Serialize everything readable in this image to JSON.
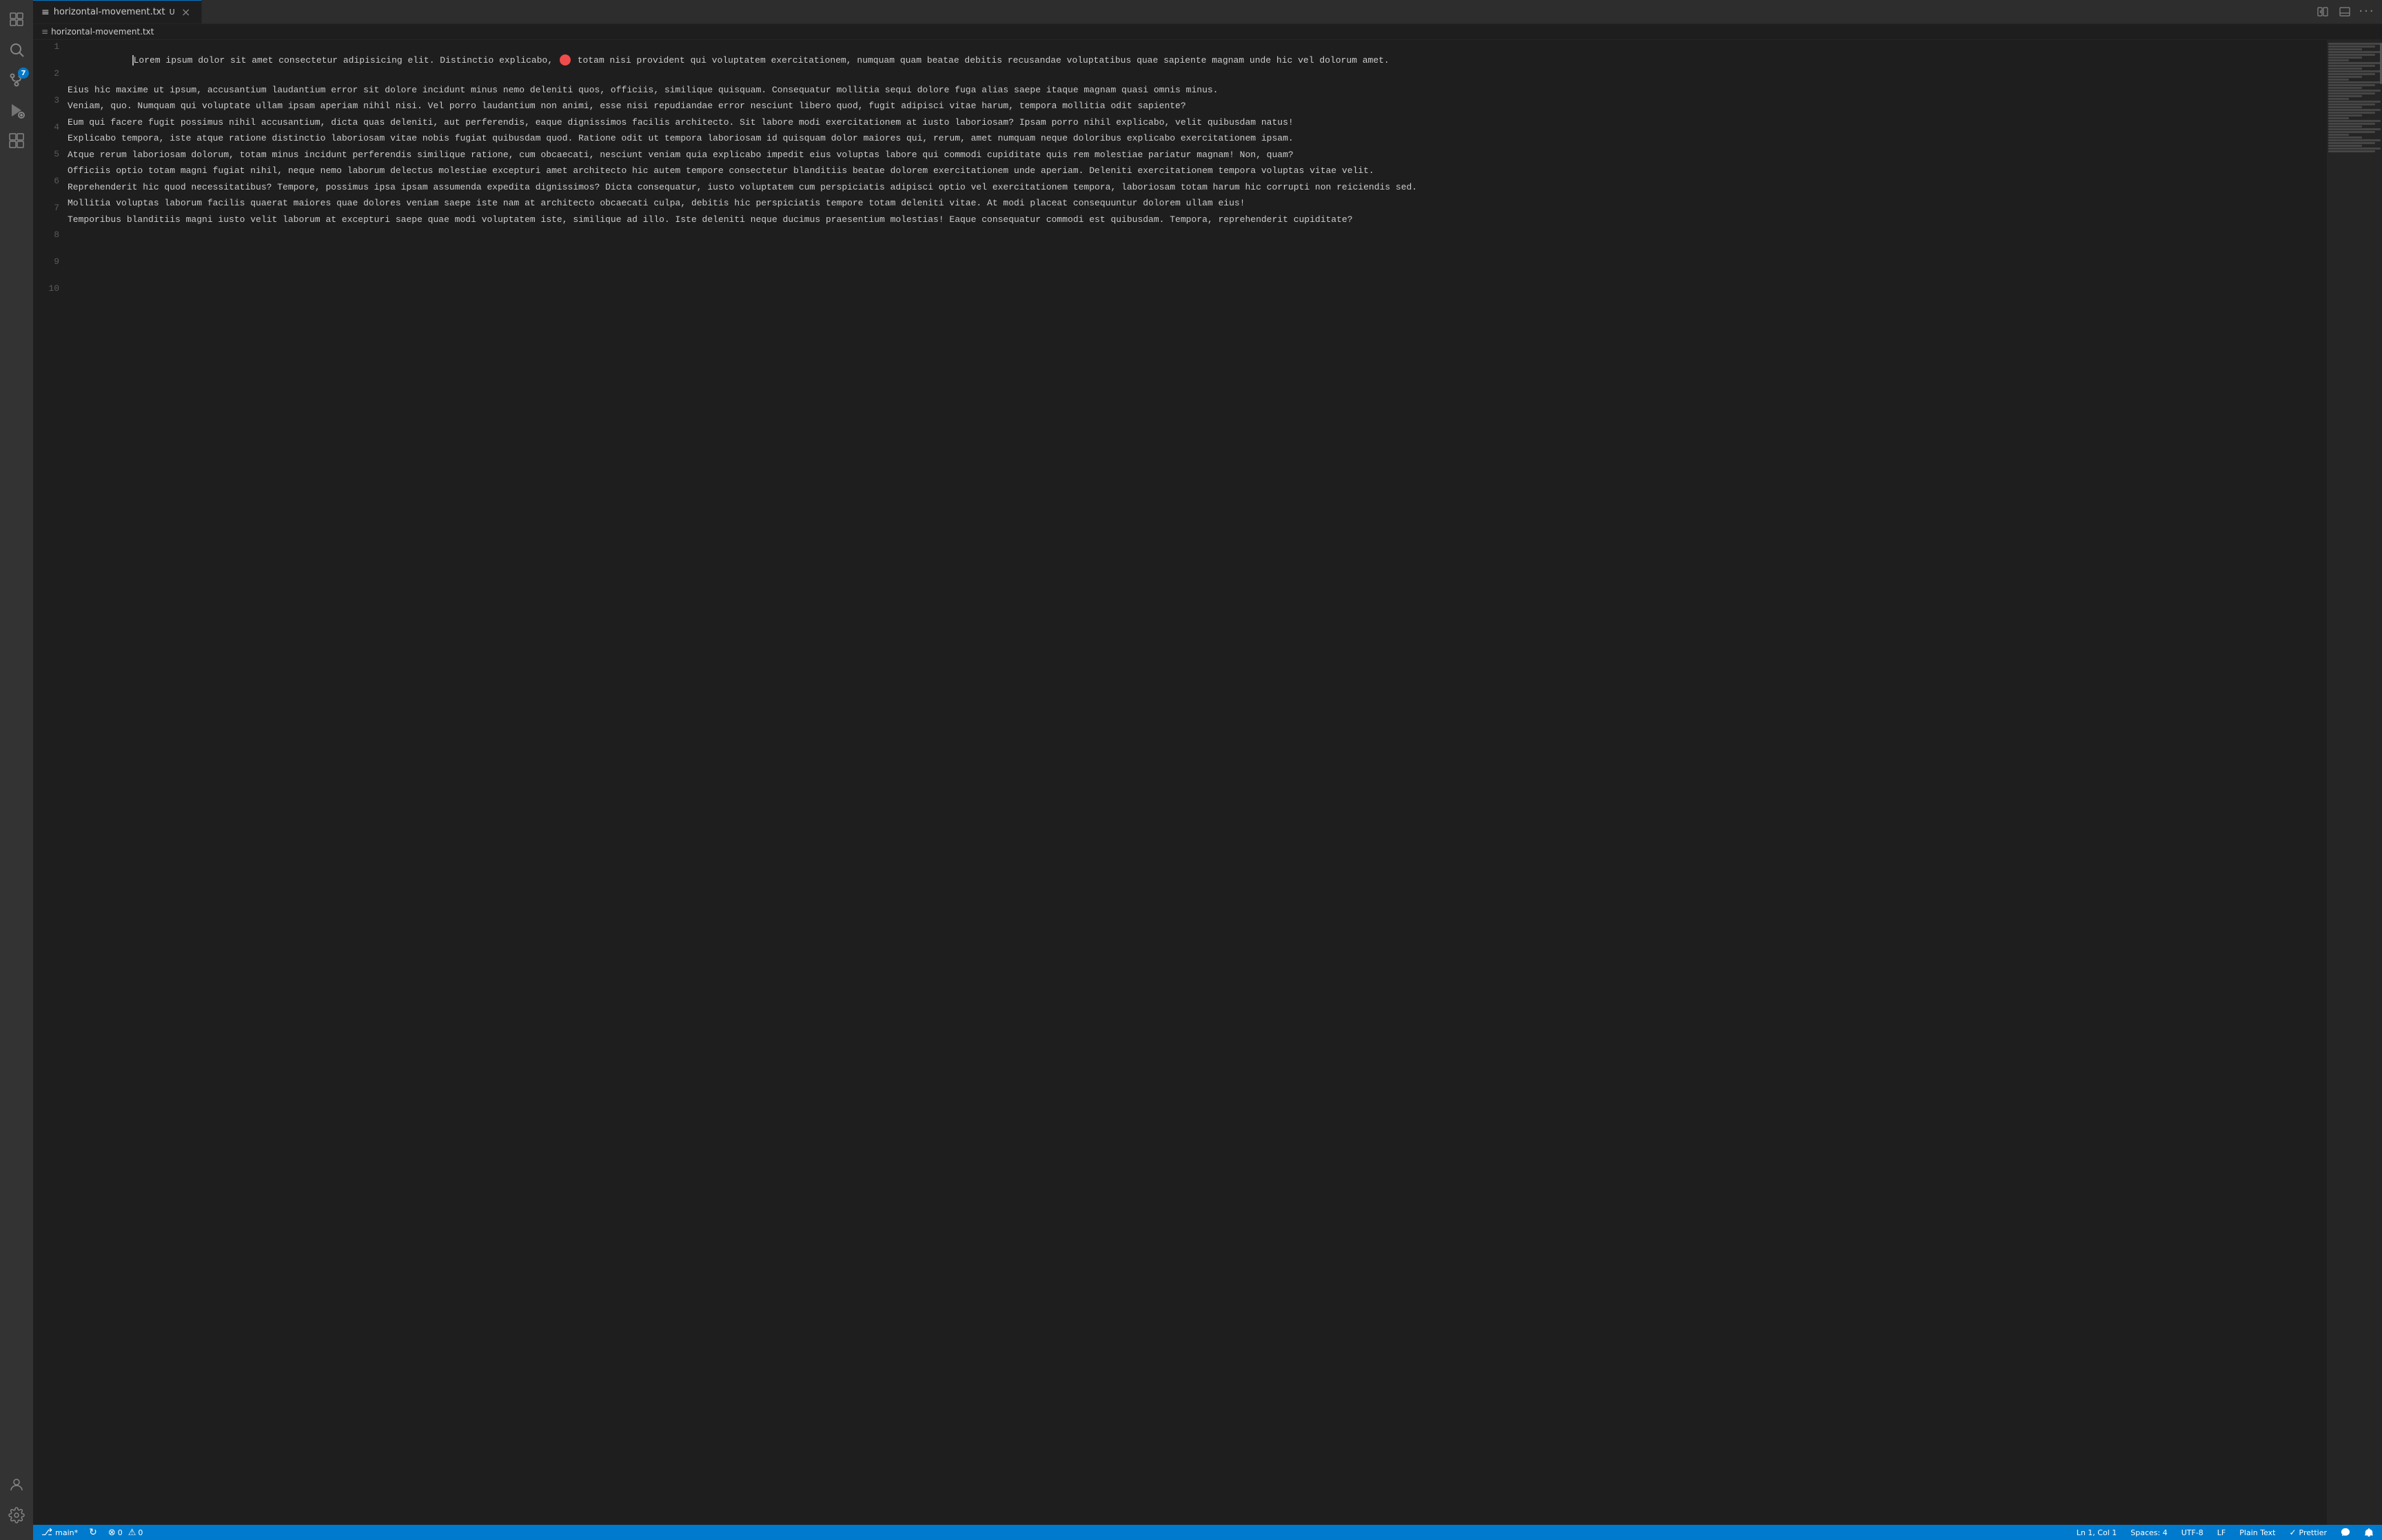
{
  "activityBar": {
    "icons": [
      {
        "name": "explorer-icon",
        "symbol": "⬜",
        "active": false,
        "badge": null
      },
      {
        "name": "search-icon",
        "symbol": "🔍",
        "active": false,
        "badge": null
      },
      {
        "name": "source-control-icon",
        "symbol": "⎇",
        "active": false,
        "badge": "7"
      },
      {
        "name": "run-debug-icon",
        "symbol": "▷",
        "active": false,
        "badge": null
      },
      {
        "name": "extensions-icon",
        "symbol": "⊞",
        "active": false,
        "badge": null
      }
    ],
    "bottomIcons": [
      {
        "name": "account-icon",
        "symbol": "👤",
        "active": false
      },
      {
        "name": "settings-icon",
        "symbol": "⚙",
        "active": false
      }
    ]
  },
  "tabs": [
    {
      "label": "horizontal-movement.txt",
      "modified": "U",
      "active": true,
      "icon": "≡"
    }
  ],
  "tabActions": [
    {
      "name": "split-editor-icon",
      "symbol": "⧉"
    },
    {
      "name": "toggle-panel-icon",
      "symbol": "▣"
    },
    {
      "name": "more-actions-icon",
      "symbol": "···"
    }
  ],
  "breadcrumb": {
    "icon": "≡",
    "filename": "horizontal-movement.txt"
  },
  "editor": {
    "lines": [
      {
        "num": 1,
        "text": "Lorem ipsum dolor sit amet consectetur adipisicing elit. Distinctio explicabo,  totam nisi provident qui voluptatem exercitationem, numquam quam beatae debitis recusandae voluptatibus quae sapiente magnam unde hic vel dolorum amet.",
        "hasBookmark": true,
        "hasCursor": true
      },
      {
        "num": 2,
        "text": "Eius hic maxime ut ipsum, accusantium laudantium error sit dolore incidunt minus nemo deleniti quos, officiis, similique quisquam. Consequatur mollitia sequi dolore fuga alias saepe itaque magnam quasi omnis minus.",
        "hasBookmark": false,
        "hasCursor": false
      },
      {
        "num": 3,
        "text": "Veniam, quo. Numquam qui voluptate ullam ipsam aperiam nihil nisi. Vel porro laudantium non animi, esse nisi repudiandae error nesciunt libero quod, fugit adipisci vitae harum, tempora mollitia odit sapiente?",
        "hasBookmark": false,
        "hasCursor": false
      },
      {
        "num": 4,
        "text": "Eum qui facere fugit possimus nihil accusantium, dicta quas deleniti, aut perferendis, eaque dignissimos facilis architecto. Sit labore modi exercitationem at iusto laboriosam? Ipsam porro nihil explicabo, velit quibusdam natus!",
        "hasBookmark": false,
        "hasCursor": false
      },
      {
        "num": 5,
        "text": "Explicabo tempora, iste atque ratione distinctio laboriosam vitae nobis fugiat quibusdam quod. Ratione odit ut tempora laboriosam id quisquam dolor maiores qui, rerum, amet numquam neque doloribus explicabo exercitationem ipsam.",
        "hasBookmark": false,
        "hasCursor": false
      },
      {
        "num": 6,
        "text": "Atque rerum laboriosam dolorum, totam minus incidunt perferendis similique ratione, cum obcaecati, nesciunt veniam quia explicabo impedit eius voluptas labore qui commodi cupiditate quis rem molestiae pariatur magnam! Non, quam?",
        "hasBookmark": false,
        "hasCursor": false
      },
      {
        "num": 7,
        "text": "Officiis optio totam magni fugiat nihil, neque nemo laborum delectus molestiae excepturi amet architecto hic autem tempore consectetur blanditiis beatae dolorem exercitationem unde aperiam. Deleniti exercitationem tempora voluptas vitae velit.",
        "hasBookmark": false,
        "hasCursor": false
      },
      {
        "num": 8,
        "text": "Reprehenderit hic quod necessitatibus? Tempore, possimus ipsa ipsam assumenda expedita dignissimos? Dicta consequatur, iusto voluptatem cum perspiciatis adipisci optio vel exercitationem tempora, laboriosam totam harum hic corrupti non reiciendis sed.",
        "hasBookmark": false,
        "hasCursor": false
      },
      {
        "num": 9,
        "text": "Mollitia voluptas laborum facilis quaerat maiores quae dolores veniam saepe iste nam at architecto obcaecati culpa, debitis hic perspiciatis tempore totam deleniti vitae. At modi placeat consequuntur dolorem ullam eius!",
        "hasBookmark": false,
        "hasCursor": false
      },
      {
        "num": 10,
        "text": "Temporibus blanditiis magni iusto velit laborum at excepturi saepe quae modi voluptatem iste, similique ad illo. Iste deleniti neque ducimus praesentium molestias! Eaque consequatur commodi est quibusdam. Tempora, reprehenderit cupiditate?",
        "hasBookmark": false,
        "hasCursor": false
      }
    ]
  },
  "statusBar": {
    "branch": "main*",
    "syncIcon": "↻",
    "errors": "0",
    "warnings": "0",
    "position": "Ln 1, Col 1",
    "spaces": "Spaces: 4",
    "encoding": "UTF-8",
    "lineEnding": "LF",
    "language": "Plain Text",
    "formatter": "Prettier",
    "notificationsIcon": "🔔",
    "feedbackIcon": "💬"
  }
}
